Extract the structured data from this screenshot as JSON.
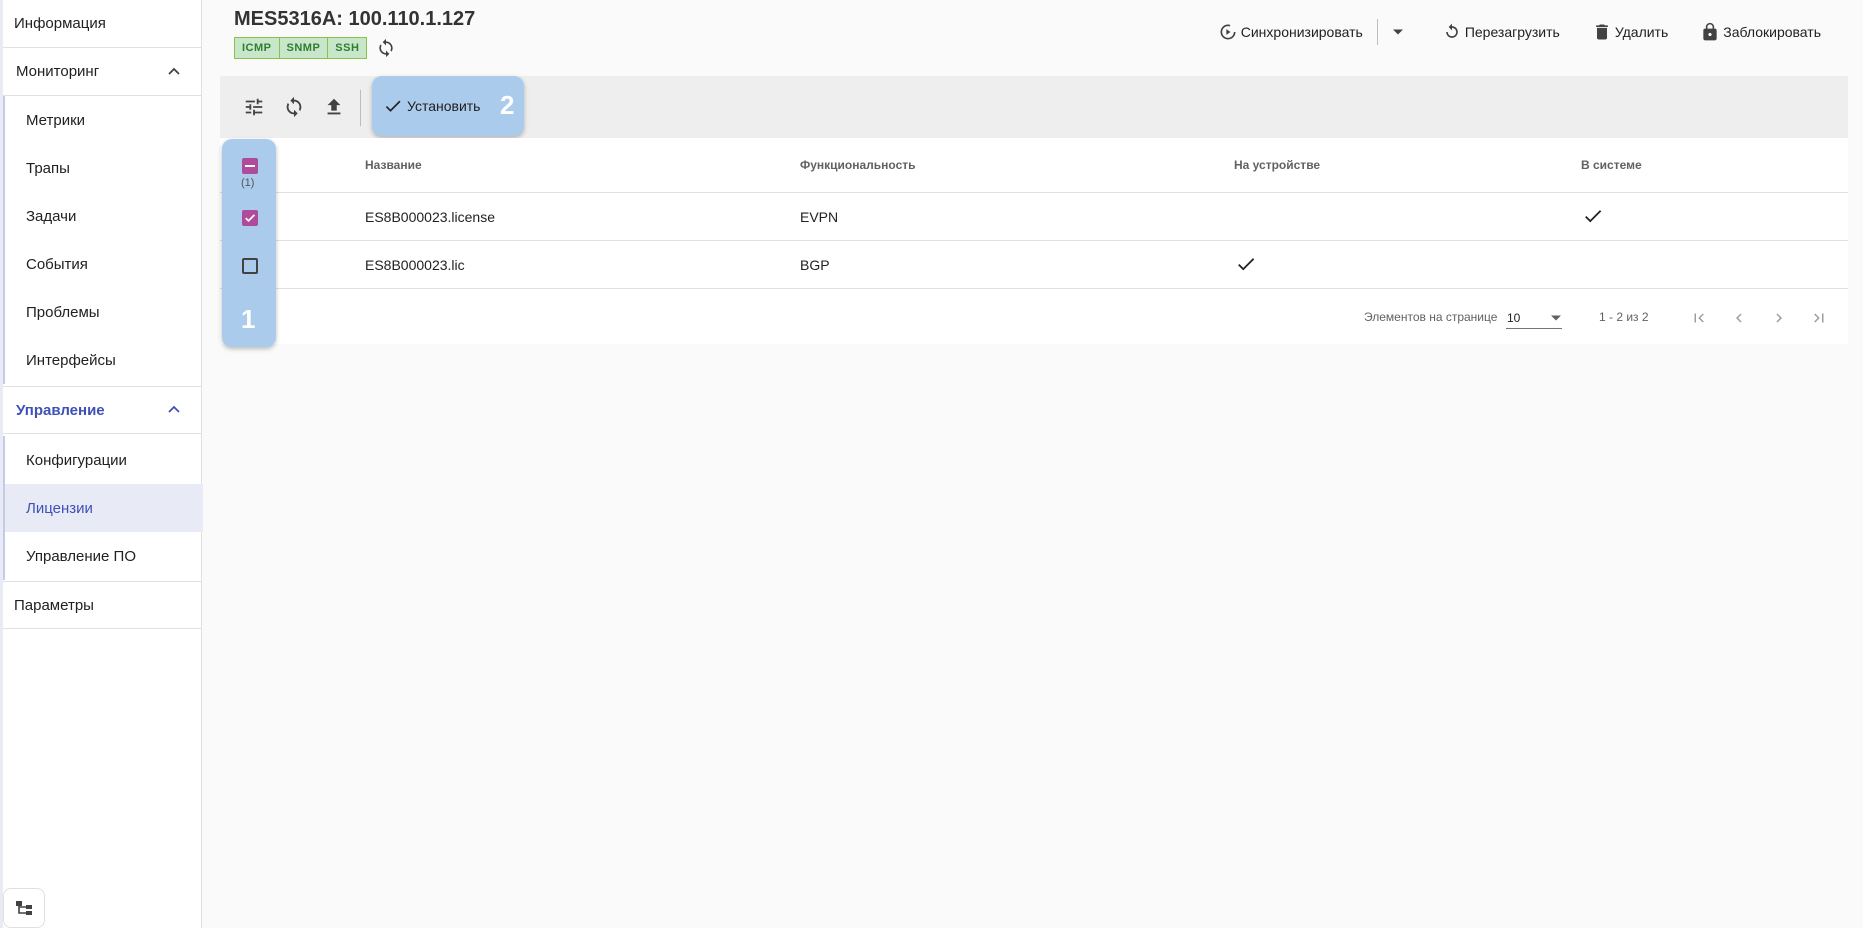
{
  "sidebar": {
    "info": "Информация",
    "monitoring": {
      "label": "Мониторинг",
      "items": [
        "Метрики",
        "Трапы",
        "Задачи",
        "События",
        "Проблемы",
        "Интерфейсы"
      ]
    },
    "management": {
      "label": "Управление",
      "items": [
        "Конфигурации",
        "Лицензии",
        "Управление ПО"
      ],
      "selected": "Лицензии"
    },
    "params": "Параметры"
  },
  "header": {
    "title": "MES5316A: 100.110.1.127",
    "badges": [
      "ICMP",
      "SNMP",
      "SSH"
    ],
    "actions": {
      "sync": "Синхронизировать",
      "reboot": "Перезагрузить",
      "delete": "Удалить",
      "lock": "Заблокировать"
    }
  },
  "toolbar": {
    "install": "Установить"
  },
  "markers": {
    "select": "1",
    "install": "2"
  },
  "table": {
    "selected_count": "(1)",
    "columns": {
      "name": "Название",
      "feature": "Функциональность",
      "on_device": "На устройстве",
      "in_system": "В системе"
    },
    "rows": [
      {
        "name": "ES8B000023.license",
        "feature": "EVPN",
        "checked": true,
        "on_device": false,
        "in_system": true
      },
      {
        "name": "ES8B000023.lic",
        "feature": "BGP",
        "checked": false,
        "on_device": true,
        "in_system": false
      }
    ]
  },
  "paginator": {
    "label": "Элементов на странице",
    "page_size": "10",
    "range": "1 - 2 из 2"
  },
  "colors": {
    "accent": "#3f51b5",
    "checkbox": "#b04a9b",
    "highlight": "#abcbec",
    "badge_bg": "#c8e6c9"
  }
}
